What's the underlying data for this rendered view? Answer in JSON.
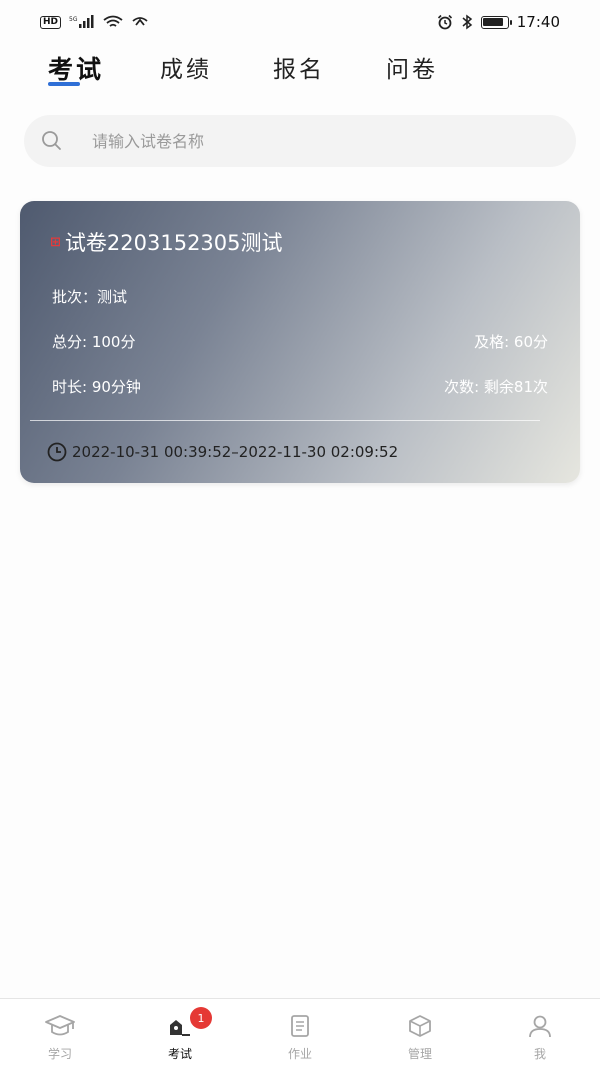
{
  "status_bar": {
    "time": "17:40",
    "hd": "HD",
    "signal_label": "5G",
    "icons": [
      "signal-icon",
      "wifi-icon",
      "alarm-icon",
      "bluetooth-icon",
      "battery-icon"
    ]
  },
  "tabs": [
    {
      "label": "考试",
      "active": true
    },
    {
      "label": "成绩",
      "active": false
    },
    {
      "label": "报名",
      "active": false
    },
    {
      "label": "问卷",
      "active": false
    }
  ],
  "search": {
    "placeholder": "请输入试卷名称",
    "icon": "search-icon"
  },
  "exam_card": {
    "title": "试卷2203152305测试",
    "batch": "批次：测试",
    "total_score": "总分: 100分",
    "pass_score": "及格: 60分",
    "duration": "时长: 90分钟",
    "attempts": "次数: 剩余81次",
    "time_range": "2022-10-31 00:39:52–2022-11-30 02:09:52"
  },
  "bottom_nav": [
    {
      "label": "学习",
      "icon": "graduation-cap-icon",
      "active": false
    },
    {
      "label": "考试",
      "icon": "exam-icon",
      "active": true,
      "badge": "1"
    },
    {
      "label": "作业",
      "icon": "document-icon",
      "active": false
    },
    {
      "label": "管理",
      "icon": "cube-icon",
      "active": false
    },
    {
      "label": "我",
      "icon": "user-icon",
      "active": false
    }
  ],
  "colors": {
    "accent": "#2f6fd6",
    "badge": "#e53935",
    "exam_mark": "#e23b3b"
  }
}
